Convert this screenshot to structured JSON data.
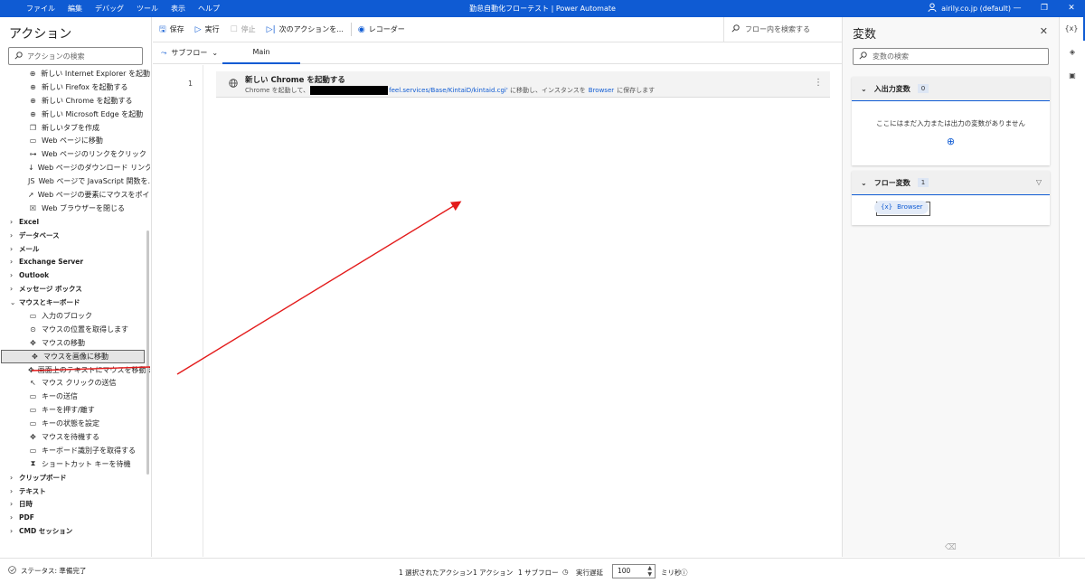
{
  "window": {
    "title": "勤怠自動化フローテスト | Power Automate",
    "menu": [
      "ファイル",
      "編集",
      "デバッグ",
      "ツール",
      "表示",
      "ヘルプ"
    ],
    "account": "airily.co.jp (default)",
    "controls": [
      "—",
      "❐",
      "✕"
    ]
  },
  "actions_panel": {
    "title": "アクション",
    "search_placeholder": "アクションの検索",
    "items": [
      {
        "kind": "child",
        "icon": "globe-icon",
        "glyph": "⊕",
        "label": "新しい Internet Explorer を起動"
      },
      {
        "kind": "child",
        "icon": "globe-icon",
        "glyph": "⊕",
        "label": "新しい Firefox を起動する"
      },
      {
        "kind": "child",
        "icon": "globe-icon",
        "glyph": "⊕",
        "label": "新しい Chrome を起動する"
      },
      {
        "kind": "child",
        "icon": "globe-icon",
        "glyph": "⊕",
        "label": "新しい Microsoft Edge を起動"
      },
      {
        "kind": "child",
        "icon": "new-tab-icon",
        "glyph": "❐",
        "label": "新しいタブを作成"
      },
      {
        "kind": "child",
        "icon": "page-icon",
        "glyph": "▭",
        "label": "Web ページに移動"
      },
      {
        "kind": "child",
        "icon": "link-icon",
        "glyph": "⊶",
        "label": "Web ページのリンクをクリック"
      },
      {
        "kind": "child",
        "icon": "download-icon",
        "glyph": "↓",
        "label": "Web ページのダウンロード リンクをク..."
      },
      {
        "kind": "child",
        "icon": "js-icon",
        "glyph": "JS",
        "label": "Web ページで JavaScript 関数を..."
      },
      {
        "kind": "child",
        "icon": "pointer-icon",
        "glyph": "➚",
        "label": "Web ページの要素にマウスをポイント"
      },
      {
        "kind": "child",
        "icon": "close-box-icon",
        "glyph": "☒",
        "label": "Web ブラウザーを閉じる"
      },
      {
        "kind": "cat",
        "label": "Excel"
      },
      {
        "kind": "cat",
        "label": "データベース"
      },
      {
        "kind": "cat",
        "label": "メール"
      },
      {
        "kind": "cat",
        "label": "Exchange Server"
      },
      {
        "kind": "cat",
        "label": "Outlook"
      },
      {
        "kind": "cat",
        "label": "メッセージ ボックス"
      },
      {
        "kind": "cat-open",
        "label": "マウスとキーボード"
      },
      {
        "kind": "child",
        "icon": "keyboard-icon",
        "glyph": "▭",
        "label": "入力のブロック"
      },
      {
        "kind": "child",
        "icon": "mouse-position-icon",
        "glyph": "⊙",
        "label": "マウスの位置を取得します"
      },
      {
        "kind": "child",
        "icon": "move-icon",
        "glyph": "✥",
        "label": "マウスの移動"
      },
      {
        "kind": "child",
        "icon": "move-icon",
        "glyph": "✥",
        "label": "マウスを画像に移動",
        "selected": true
      },
      {
        "kind": "child",
        "icon": "move-icon",
        "glyph": "✥",
        "label": "画面上のテキストにマウスを移動す..."
      },
      {
        "kind": "child",
        "icon": "click-icon",
        "glyph": "↖",
        "label": "マウス クリックの送信"
      },
      {
        "kind": "child",
        "icon": "keyboard-icon",
        "glyph": "▭",
        "label": "キーの送信"
      },
      {
        "kind": "child",
        "icon": "keyboard-icon",
        "glyph": "▭",
        "label": "キーを押す/離す"
      },
      {
        "kind": "child",
        "icon": "keyboard-icon",
        "glyph": "▭",
        "label": "キーの状態を設定"
      },
      {
        "kind": "child",
        "icon": "move-icon",
        "glyph": "✥",
        "label": "マウスを待機する"
      },
      {
        "kind": "child",
        "icon": "keyboard-icon",
        "glyph": "▭",
        "label": "キーボード識別子を取得する"
      },
      {
        "kind": "child",
        "icon": "hourglass-icon",
        "glyph": "⧗",
        "label": "ショートカット キーを待機"
      },
      {
        "kind": "cat",
        "label": "クリップボード"
      },
      {
        "kind": "cat",
        "label": "テキスト"
      },
      {
        "kind": "cat",
        "label": "日時"
      },
      {
        "kind": "cat",
        "label": "PDF"
      },
      {
        "kind": "cat",
        "label": "CMD セッション"
      }
    ]
  },
  "toolbar": {
    "save": "保存",
    "run": "実行",
    "stop": "停止",
    "next_action": "次のアクションを...",
    "recorder": "レコーダー",
    "flow_search": "フロー内を検索する"
  },
  "tabs": {
    "subflow": "サブフロー",
    "main": "Main"
  },
  "flow": {
    "steps": [
      {
        "line": "1",
        "title": "新しい Chrome を起動する",
        "desc_prefix": "Chrome を起動して、",
        "url_suffix": "feel.services/Base/KintaiD/kintaid.cgi'",
        "desc_mid": " に移動し、インスタンスを",
        "variable": "Browser",
        "desc_suffix": "に保存します"
      }
    ]
  },
  "variables_panel": {
    "title": "変数",
    "search_placeholder": "変数の検索",
    "io_section": {
      "label": "入出力変数",
      "count": "0",
      "empty_text": "ここにはまだ入力または出力の変数がありません"
    },
    "flow_section": {
      "label": "フロー変数",
      "count": "1",
      "vars": [
        {
          "prefix": "{x}",
          "name": "Browser"
        }
      ]
    }
  },
  "rail": [
    "{x}",
    "◈",
    "▣"
  ],
  "statusbar": {
    "status": "ステータス: 準備完了",
    "selected_actions": "1 選択されたアクション",
    "action_count": "1 アクション",
    "subflow_count": "1 サブフロー",
    "delay_label": "実行遅延",
    "delay_value": "100",
    "unit": "ミリ秒"
  },
  "colors": {
    "accent": "#0f5bd3",
    "annotation": "#e31b1b"
  }
}
